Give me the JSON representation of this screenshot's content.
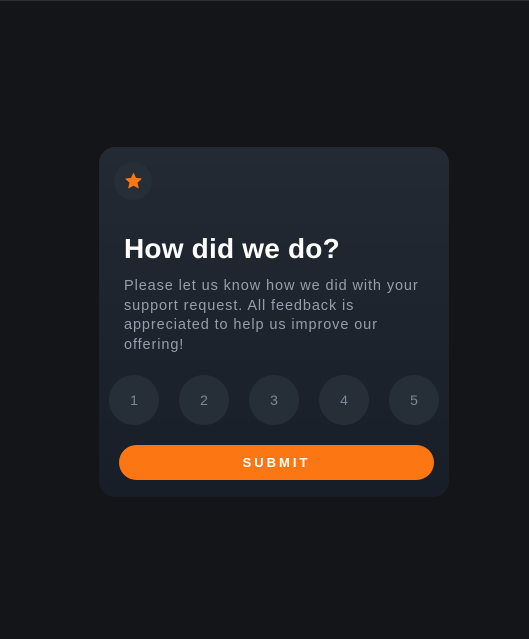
{
  "card": {
    "icon": "star-icon",
    "title": "How did we do?",
    "description": "Please let us know how we did with your support request. All feedback is appreciated to help us improve our offering!",
    "ratings": [
      "1",
      "2",
      "3",
      "4",
      "5"
    ],
    "submit_label": "SUBMIT"
  },
  "colors": {
    "background": "#131518",
    "card": "#232a34",
    "accent": "#fc7614",
    "rating_circle": "#262e38",
    "muted_text": "#959eac"
  }
}
